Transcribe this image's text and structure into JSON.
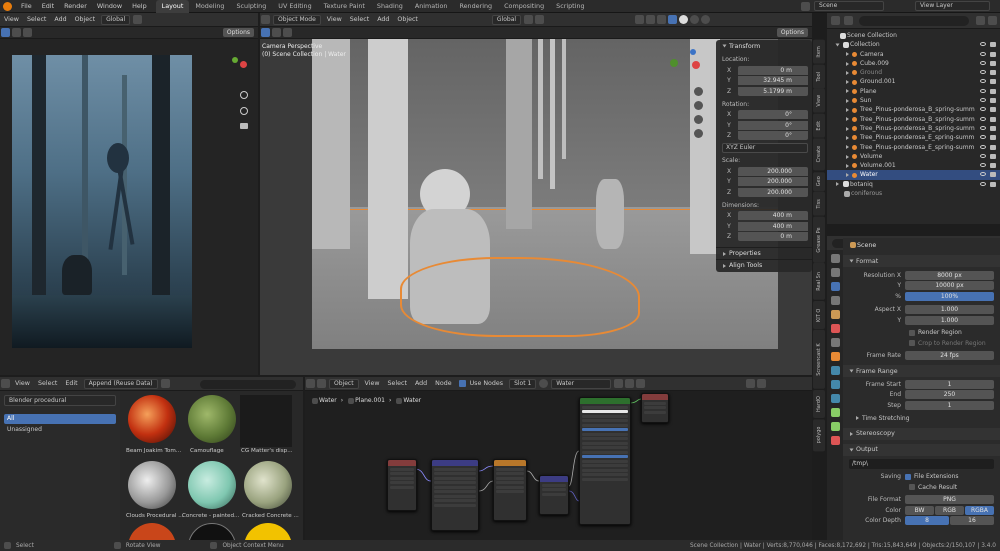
{
  "menu": [
    "File",
    "Edit",
    "Render",
    "Window",
    "Help"
  ],
  "workspaces": [
    "Layout",
    "Modeling",
    "Sculpting",
    "UV Editing",
    "Texture Paint",
    "Shading",
    "Animation",
    "Rendering",
    "Compositing",
    "Scripting"
  ],
  "scene_name": "Scene",
  "view_layer": "View Layer",
  "left_header": {
    "view": "View",
    "select": "Select",
    "add": "Add",
    "object": "Object",
    "transform": "Global",
    "options": "Options"
  },
  "viewport_header": {
    "mode": "Object Mode",
    "view": "View",
    "select": "Select",
    "add": "Add",
    "object": "Object",
    "transform": "Global",
    "options": "Options"
  },
  "viewport_overlay": {
    "line1": "Camera Perspective",
    "line2": "(0) Scene Collection | Water"
  },
  "npanel": {
    "transform": "Transform",
    "location": "Location:",
    "rotation": "Rotation:",
    "rotation_mode": "XYZ Euler",
    "scale": "Scale:",
    "dimensions": "Dimensions:",
    "loc": [
      {
        "a": "X",
        "v": "0 m"
      },
      {
        "a": "Y",
        "v": "32.945 m"
      },
      {
        "a": "Z",
        "v": "5.1799 m"
      }
    ],
    "rot": [
      {
        "a": "X",
        "v": "0°"
      },
      {
        "a": "Y",
        "v": "0°"
      },
      {
        "a": "Z",
        "v": "0°"
      }
    ],
    "scl": [
      {
        "a": "X",
        "v": "200.000"
      },
      {
        "a": "Y",
        "v": "200.000"
      },
      {
        "a": "Z",
        "v": "200.000"
      }
    ],
    "dim": [
      {
        "a": "X",
        "v": "400 m"
      },
      {
        "a": "Y",
        "v": "400 m"
      },
      {
        "a": "Z",
        "v": "0 m"
      }
    ],
    "properties": "Properties",
    "align_tools": "Align Tools"
  },
  "side_tabs": [
    "Item",
    "Tool",
    "View",
    "Edit",
    "Create",
    "Geo",
    "Tiss",
    "Grease Pe",
    "Real Sn",
    "KIT O",
    "Screencast K",
    "HardO",
    "polygo"
  ],
  "outliner": {
    "root": "Scene Collection",
    "collection": "Collection",
    "items": [
      "Camera",
      "Cube.009",
      "Ground",
      "Ground.001",
      "Plane",
      "Sun",
      "Tree_Pinus-ponderosa_B_spring-summ",
      "Tree_Pinus-ponderosa_B_spring-summ",
      "Tree_Pinus-ponderosa_B_spring-summ",
      "Tree_Pinus-ponderosa_E_spring-summ",
      "Tree_Pinus-ponderosa_E_spring-summ",
      "Volume",
      "Volume.001",
      "Water"
    ],
    "botaniq": "botaniq",
    "coniferous": "coniferous"
  },
  "properties": {
    "scene": "Scene",
    "format": "Format",
    "res_x_label": "Resolution X",
    "res_x": "8000 px",
    "res_y_label": "Y",
    "res_y": "10000 px",
    "pct_label": "%",
    "pct": "100%",
    "aspect_label": "Aspect X",
    "aspect_x": "1.000",
    "aspect_y_label": "Y",
    "aspect_y": "1.000",
    "render_region": "Render Region",
    "crop": "Crop to Render Region",
    "frame_rate_label": "Frame Rate",
    "frame_rate": "24 fps",
    "frame_range": "Frame Range",
    "frame_start_label": "Frame Start",
    "frame_start": "1",
    "end_label": "End",
    "end": "250",
    "step_label": "Step",
    "step": "1",
    "time_stretching": "Time Stretching",
    "stereoscopy": "Stereoscopy",
    "output": "Output",
    "path": "/tmp\\",
    "saving_label": "Saving",
    "file_extensions": "File Extensions",
    "cache_result": "Cache Result",
    "file_format_label": "File Format",
    "file_format": "PNG",
    "color_label": "Color",
    "color_bw": "BW",
    "color_rgb": "RGB",
    "color_rgba": "RGBA",
    "depth_label": "Color Depth",
    "depth_8": "8",
    "depth_16": "16"
  },
  "asset_browser": {
    "view": "View",
    "select": "Select",
    "edit": "Edit",
    "import": "Append (Reuse Data)",
    "library": "Blender procedural",
    "cat_all": "All",
    "cat_unassigned": "Unassigned",
    "assets": [
      "Beam Joakim Tom...",
      "Camouflage",
      "CG Matter's disp...",
      "Clouds Procedural ...",
      "Concrete - painted...",
      "Cracked Concrete ..."
    ]
  },
  "node_editor": {
    "object": "Object",
    "view": "View",
    "select": "Select",
    "add": "Add",
    "node": "Node",
    "use_nodes": "Use Nodes",
    "slot": "Slot 1",
    "material": "Water",
    "crumb1": "Water",
    "crumb2": "Plane.001",
    "crumb3": "Water"
  },
  "status": {
    "select": "Select",
    "rotate": "Rotate View",
    "context": "Object Context Menu",
    "stats": "Scene Collection | Water | Verts:8,770,046 | Faces:8,172,692 | Tris:15,843,649 | Objects:2/150,107 | 3.4.0"
  },
  "colors": {
    "accent": "#4772b3",
    "selection": "#e88a35",
    "header": "#303030",
    "panel": "#2b2b2b"
  }
}
